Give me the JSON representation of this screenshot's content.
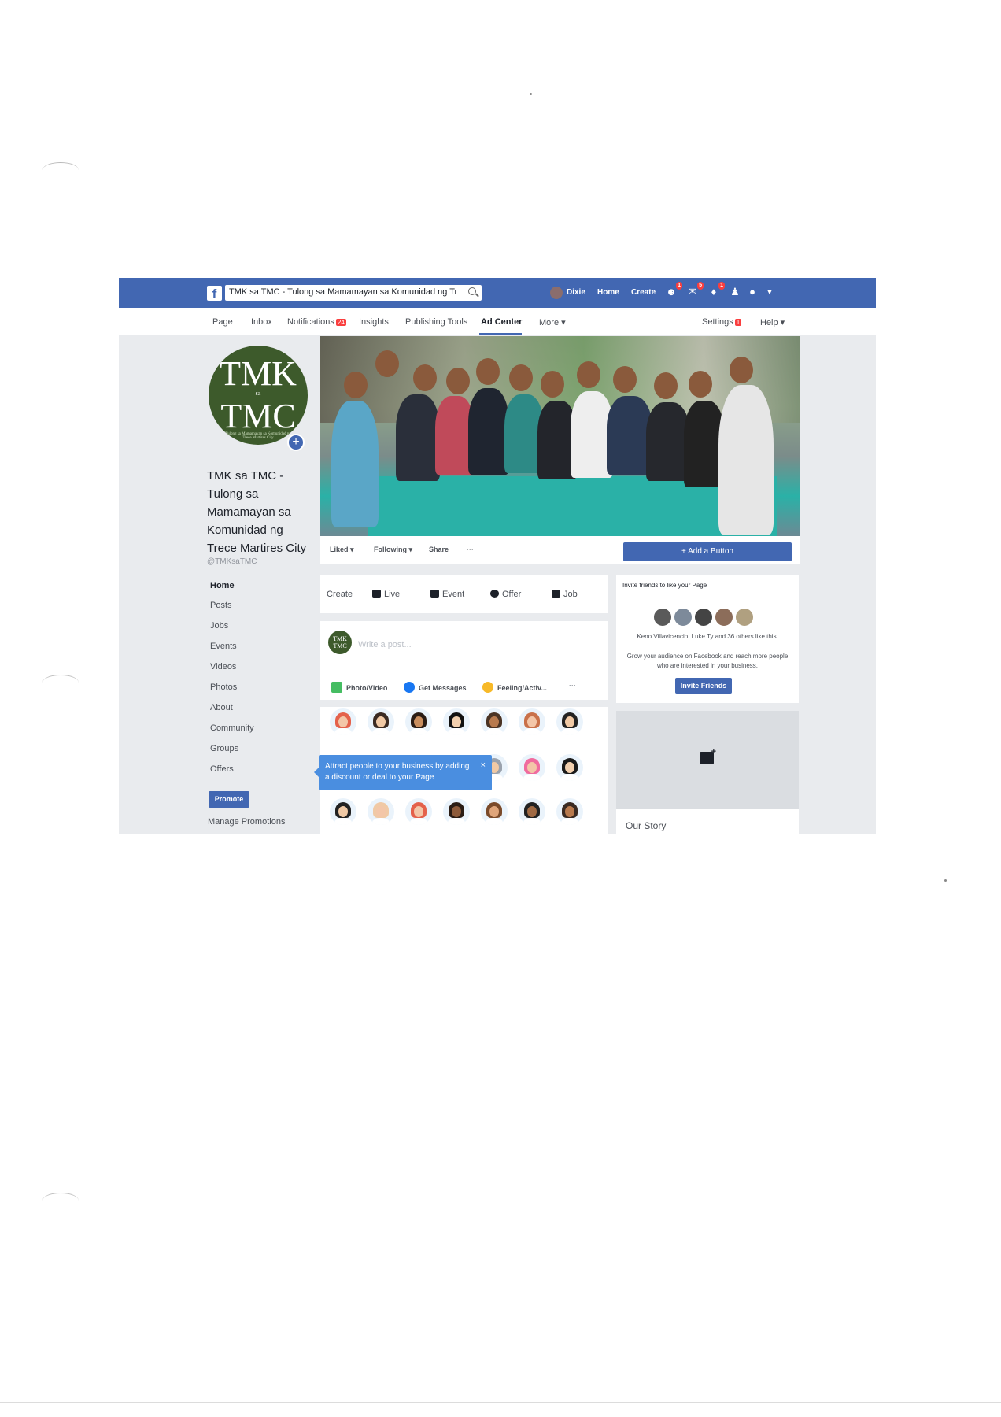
{
  "bluebar": {
    "logo": "f",
    "search_text": "TMK sa TMC - Tulong sa Mamamayan sa Komunidad ng Tr…",
    "user_name": "Dixie",
    "home": "Home",
    "create": "Create",
    "friend_badge": "1",
    "messages_badge": "5",
    "notifications_badge": "1"
  },
  "pagenav": {
    "items": [
      {
        "label": "Page"
      },
      {
        "label": "Inbox"
      },
      {
        "label": "Notifications",
        "badge": "24"
      },
      {
        "label": "Insights"
      },
      {
        "label": "Publishing Tools"
      },
      {
        "label": "Ad Center"
      },
      {
        "label": "More ▾"
      }
    ],
    "settings": "Settings",
    "settings_badge": "1",
    "help": "Help ▾"
  },
  "profile": {
    "logo_line1": "TMK",
    "logo_sa": "sa",
    "logo_line2": "TMC",
    "logo_small": "Tulong sa Mamamayan sa Komunidad ng Trece Martires City",
    "name": "TMK sa TMC - Tulong sa Mamamayan sa Komunidad ng Trece Martires City",
    "handle": "@TMKsaTMC"
  },
  "sidebar": {
    "items": [
      {
        "label": "Home"
      },
      {
        "label": "Posts"
      },
      {
        "label": "Jobs"
      },
      {
        "label": "Events"
      },
      {
        "label": "Videos"
      },
      {
        "label": "Photos"
      },
      {
        "label": "About"
      },
      {
        "label": "Community"
      },
      {
        "label": "Groups"
      },
      {
        "label": "Offers"
      }
    ],
    "promote": "Promote",
    "manage_promotions": "Manage Promotions"
  },
  "actions": {
    "liked": "Liked ▾",
    "following": "Following ▾",
    "share": "Share",
    "more": "···",
    "add_button": "+ Add a Button"
  },
  "composer": {
    "create": "Create",
    "live": "Live",
    "event": "Event",
    "offer": "Offer",
    "job": "Job",
    "placeholder": "Write a post...",
    "photo_video": "Photo/Video",
    "get_messages": "Get Messages",
    "feeling": "Feeling/Activ...",
    "more": "···",
    "avatar_text": "TMK TMC"
  },
  "tooltip": {
    "text": "Attract people to your business by adding a discount or deal to your Page",
    "close": "×"
  },
  "invite": {
    "title": "Invite friends to like your Page",
    "likers": "Keno Villavicencio, Luke Ty and 36 others like this",
    "description": "Grow your audience on Facebook and reach more people who are interested in your business.",
    "button": "Invite Friends"
  },
  "story": {
    "title": "Our Story"
  },
  "colors": {
    "brand": "#4267b2",
    "tooltip": "#4a8ee0",
    "badge": "#fa3e3e"
  }
}
